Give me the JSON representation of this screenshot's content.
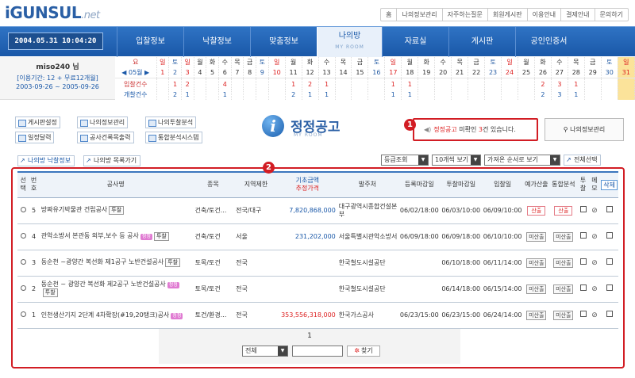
{
  "header": {
    "logo_main": "iGUNSUL",
    "logo_net": ".net",
    "top_links": [
      "홈",
      "나의정보관리",
      "자주하는질문",
      "회원게시판",
      "이용안내",
      "결제안내",
      "문의하기"
    ]
  },
  "nav": {
    "datetime": "2004.05.31 10:04:20",
    "menu": [
      "입찰정보",
      "낙찰정보",
      "맞춤정보",
      "나의방",
      "자료실",
      "게시판",
      "공인인증서"
    ],
    "active_sub": "MY ROOM"
  },
  "user": {
    "name": "miso240 님",
    "period": "[이용기간: 12 + 무료12개월]",
    "range": "2003-09-26 ~ 2005-09-26"
  },
  "calendar": {
    "month_label": "◀ 05월 ▶",
    "bid_label": "입찰건수",
    "open_label": "개찰건수",
    "weekdays": [
      "요",
      "일",
      "토",
      "일",
      "월",
      "화",
      "수",
      "목",
      "금",
      "토",
      "일",
      "월",
      "화",
      "수",
      "목",
      "금",
      "토",
      "일",
      "월",
      "화",
      "수",
      "목",
      "금",
      "토",
      "일",
      "월",
      "화",
      "수",
      "목",
      "금",
      "토",
      "일"
    ],
    "days": [
      "",
      "1",
      "2",
      "3",
      "4",
      "5",
      "6",
      "7",
      "8",
      "9",
      "10",
      "11",
      "12",
      "13",
      "14",
      "15",
      "16",
      "17",
      "18",
      "19",
      "20",
      "21",
      "22",
      "23",
      "24",
      "25",
      "26",
      "27",
      "28",
      "29",
      "30",
      "31"
    ],
    "bids": [
      "",
      "",
      "1",
      "2",
      "",
      "",
      "4",
      "",
      "",
      "",
      "",
      "1",
      "2",
      "1",
      "",
      "",
      "",
      "1",
      "1",
      "",
      "",
      "",
      "",
      "",
      "",
      "",
      "2",
      "3",
      "1",
      "",
      "",
      ""
    ],
    "opens": [
      "",
      "",
      "2",
      "1",
      "",
      "",
      "1",
      "",
      "",
      "",
      "",
      "2",
      "1",
      "1",
      "",
      "",
      "",
      "1",
      "1",
      "",
      "",
      "",
      "",
      "",
      "",
      "",
      "2",
      "3",
      "1",
      "",
      "",
      ""
    ]
  },
  "tools": {
    "buttons": [
      "게시판설정",
      "나의정보관리",
      "나의투찰분석",
      "일정달력",
      "공사건록목출력",
      "통합분석시스템"
    ]
  },
  "section": {
    "title": "정정공고",
    "subtitle": "MY ROOM",
    "badge1": "1",
    "badge2": "2",
    "notice_prefix": "정정공고",
    "notice_mid": " 미확인 ",
    "notice_count": "3",
    "notice_suffix": "건 있습니다.",
    "my_info_button": "나의정보관리"
  },
  "filters": {
    "tab_active": "나의방 낙찰정보",
    "tab_other": "나의방 목록가기",
    "grade": "등급조회",
    "per_page": "10개씩 보기",
    "sort": "가져온 순서로 보기",
    "select_all": "전체선택"
  },
  "table": {
    "headers": {
      "select": "선택",
      "no": "번호",
      "name": "공사명",
      "type": "종목",
      "region": "지역제한",
      "base": "기초금액",
      "est": "추정가격",
      "org": "발주처",
      "reg_end": "등록마감일",
      "bid_end": "투찰마감일",
      "bid_date": "입찰일",
      "pred": "예가산출",
      "anal": "통합분석",
      "tuchal": "투찰",
      "memo": "메모",
      "del": "삭제"
    },
    "rows": [
      {
        "no": "5",
        "name": "방짜유기박물관 건립공사",
        "tag": "투찰",
        "pink": "",
        "type": "건축/토건...",
        "region": "전국/대구",
        "amount": "7,820,868,000",
        "amt_color": "blue",
        "org": "대구광역시종합건설본부",
        "reg": "06/02/18:00",
        "bidend": "06/03/10:00",
        "bid": "06/09/10:00",
        "pred": "산출",
        "anal": "산출",
        "pred_style": "pink"
      },
      {
        "no": "4",
        "name": "관악소방서 본관동 외부,보수 등 공사",
        "tag": "투찰",
        "pink": "정정",
        "type": "건축/토건",
        "region": "서울",
        "amount": "231,202,000",
        "amt_color": "blue",
        "org": "서울특별시관악소방서",
        "reg": "06/09/18:00",
        "bidend": "06/09/18:00",
        "bid": "06/10/10:00",
        "pred": "미산출",
        "anal": "미산출",
        "pred_style": "gray"
      },
      {
        "no": "3",
        "name": "동순천 ~광양간 복선화 제1공구 노반건설공사",
        "tag": "투찰",
        "pink": "",
        "type": "토목/토건",
        "region": "전국",
        "amount": "",
        "amt_color": "blue",
        "org": "한국철도시설공단",
        "reg": "",
        "bidend": "06/10/18:00",
        "bid": "06/11/14:00",
        "pred": "미산출",
        "anal": "미산출",
        "pred_style": "gray"
      },
      {
        "no": "2",
        "name": "동순천 ~ 광양간 복선화 제2공구 노반건설공사",
        "tag": "투찰",
        "pink": "정정",
        "type": "토목/토건",
        "region": "전국",
        "amount": "",
        "amt_color": "blue",
        "org": "한국철도시설공단",
        "reg": "",
        "bidend": "06/14/18:00",
        "bid": "06/15/14:00",
        "pred": "미산출",
        "anal": "미산출",
        "pred_style": "gray"
      },
      {
        "no": "1",
        "name": "인천생산기지 2단계 4차확장(#19,20탱크)공사",
        "tag": "",
        "pink": "정정",
        "type": "토건/환경...",
        "region": "전국",
        "amount": "353,556,318,000",
        "amt_color": "red",
        "org": "한국가스공사",
        "reg": "06/23/15:00",
        "bidend": "06/23/15:00",
        "bid": "06/24/14:00",
        "pred": "미산출",
        "anal": "미산출",
        "pred_style": "gray"
      }
    ]
  },
  "pager": {
    "page": "1",
    "search_option": "전체",
    "search_value": "",
    "search_button": "찾기"
  }
}
